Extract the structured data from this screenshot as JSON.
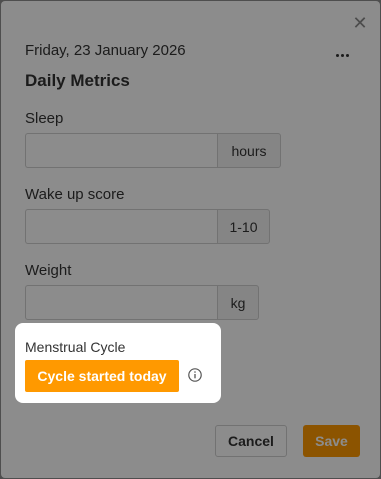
{
  "modal": {
    "close_icon": "close-icon",
    "date": "Friday, 23 January 2026",
    "more_icon": "more-options-icon",
    "title": "Daily Metrics"
  },
  "fields": {
    "sleep": {
      "label": "Sleep",
      "value": "",
      "unit": "hours"
    },
    "wake_up_score": {
      "label": "Wake up score",
      "value": "",
      "unit": "1-10"
    },
    "weight": {
      "label": "Weight",
      "value": "",
      "unit": "kg"
    }
  },
  "menstrual_cycle": {
    "label": "Menstrual Cycle",
    "button_label": "Cycle started today",
    "info_icon": "info-icon"
  },
  "footer": {
    "cancel_label": "Cancel",
    "save_label": "Save"
  },
  "colors": {
    "accent": "#ff9900",
    "overlay": "rgba(0,0,0,0.45)"
  }
}
